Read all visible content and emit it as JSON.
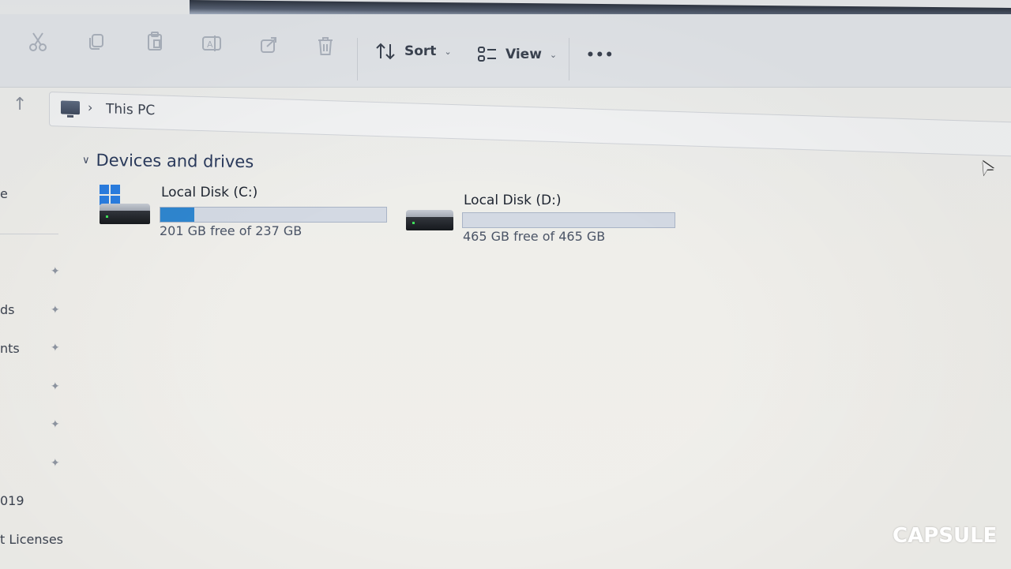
{
  "toolbar": {
    "sort_label": "Sort",
    "view_label": "View",
    "more_label": "•••"
  },
  "address": {
    "location": "This PC"
  },
  "sidebar": {
    "items": [
      {
        "label": "e"
      },
      {
        "label": ""
      },
      {
        "label": "ds"
      },
      {
        "label": "nts"
      },
      {
        "label": ""
      },
      {
        "label": ""
      },
      {
        "label": ""
      },
      {
        "label": "019"
      },
      {
        "label": "t Licenses"
      }
    ]
  },
  "section": {
    "title": "Devices and drives"
  },
  "drives": [
    {
      "name": "Local Disk (C:)",
      "free_text": "201 GB free of 237 GB",
      "used_fraction": 0.152
    },
    {
      "name": "Local Disk (D:)",
      "free_text": "465 GB free of 465 GB",
      "used_fraction": 0.0
    }
  ],
  "watermark": {
    "text": "CAPSULE"
  },
  "colors": {
    "accent": "#2f86cf",
    "windows_logo": "#2a7de0"
  }
}
